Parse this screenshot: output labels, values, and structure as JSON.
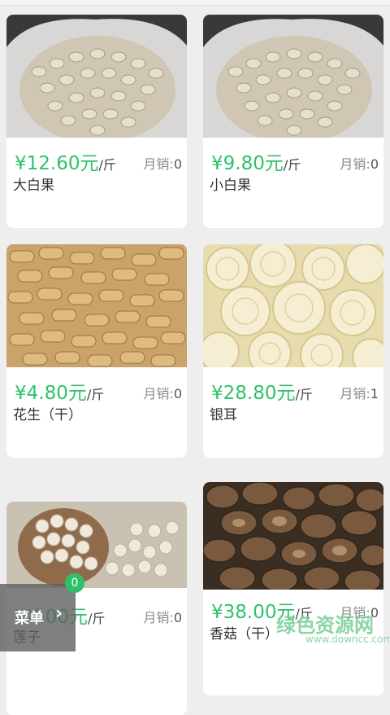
{
  "products": [
    {
      "price": "¥12.60元",
      "unit": "/斤",
      "sales_label": "月销:",
      "sales": "0",
      "name": "大白果",
      "image": "white-ginkgo-nuts-in-sack"
    },
    {
      "price": "¥9.80元",
      "unit": "/斤",
      "sales_label": "月销:",
      "sales": "0",
      "name": "小白果",
      "image": "white-ginkgo-nuts-in-sack"
    },
    {
      "price": "¥4.80元",
      "unit": "/斤",
      "sales_label": "月销:",
      "sales": "0",
      "name": "花生（干）",
      "image": "dried-peanuts-in-shell"
    },
    {
      "price": "¥28.80元",
      "unit": "/斤",
      "sales_label": "月销:",
      "sales": "1",
      "name": "银耳",
      "image": "white-fungus"
    },
    {
      "price": "¥X.00元",
      "unit": "/斤",
      "sales_label": "月销:",
      "sales": "0",
      "name": "莲子",
      "image": "lotus-seeds"
    },
    {
      "price": "¥38.00元",
      "unit": "/斤",
      "sales_label": "月销:",
      "sales": "0",
      "name": "香菇（干）",
      "image": "dried-shiitake-mushrooms"
    }
  ],
  "menu": {
    "label": "菜单",
    "chevron": "chevron-right-icon",
    "cart_count": "0"
  },
  "watermark": {
    "logo": "绿色资源网",
    "url": "www.downcc.com"
  },
  "colors": {
    "accent": "#2fc16a",
    "background": "#eeeeee"
  }
}
